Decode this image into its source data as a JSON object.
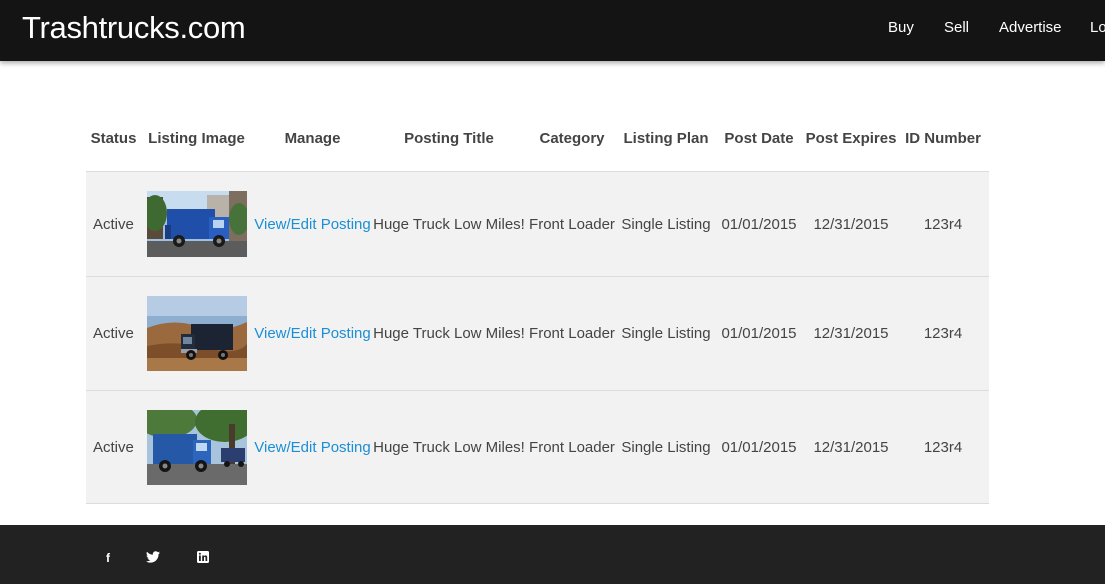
{
  "header": {
    "brand": "Trashtrucks.com",
    "nav": [
      "Buy",
      "Sell",
      "Advertise",
      "Lo"
    ]
  },
  "table": {
    "headers": {
      "status": "Status",
      "image": "Listing Image",
      "manage": "Manage",
      "title": "Posting Title",
      "category": "Category",
      "plan": "Listing Plan",
      "post_date": "Post Date",
      "post_expires": "Post Expires",
      "id_number": "ID Number"
    },
    "rows": [
      {
        "status": "Active",
        "image": "blue-garbage-truck-photo",
        "manage": "View/Edit Posting",
        "title": "Huge Truck Low Miles!",
        "category": "Front Loader",
        "plan": "Single Listing",
        "post_date": "01/01/2015",
        "post_expires": "12/31/2015",
        "id_number": "123r4"
      },
      {
        "status": "Active",
        "image": "dark-truck-desert-photo",
        "manage": "View/Edit Posting",
        "title": "Huge Truck Low Miles!",
        "category": "Front Loader",
        "plan": "Single Listing",
        "post_date": "01/01/2015",
        "post_expires": "12/31/2015",
        "id_number": "123r4"
      },
      {
        "status": "Active",
        "image": "blue-truck-street-photo",
        "manage": "View/Edit Posting",
        "title": "Huge Truck Low Miles!",
        "category": "Front Loader",
        "plan": "Single Listing",
        "post_date": "01/01/2015",
        "post_expires": "12/31/2015",
        "id_number": "123r4"
      }
    ]
  },
  "footer": {
    "social_icons": [
      "facebook-icon",
      "twitter-icon",
      "linkedin-icon"
    ],
    "social_glyphs": [
      "f",
      "🐦",
      "in"
    ]
  },
  "colors": {
    "header_bg": "#141414",
    "footer_bg": "#222222",
    "row_bg": "#f2f2f2",
    "link": "#1a8fd6"
  }
}
